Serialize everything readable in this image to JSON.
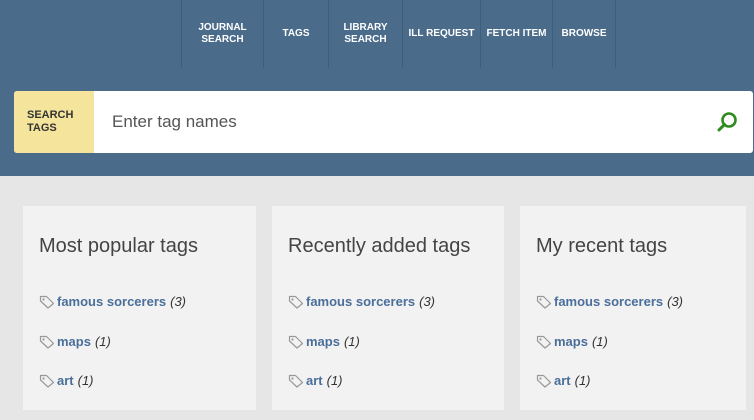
{
  "nav": {
    "items": [
      {
        "label_line1": "JOURNAL",
        "label_line2": "SEARCH"
      },
      {
        "label_line1": "TAGS",
        "label_line2": ""
      },
      {
        "label_line1": "LIBRARY",
        "label_line2": "SEARCH"
      },
      {
        "label_line1": "ILL REQUEST",
        "label_line2": ""
      },
      {
        "label_line1": "FETCH ITEM",
        "label_line2": ""
      },
      {
        "label_line1": "BROWSE",
        "label_line2": ""
      }
    ]
  },
  "search": {
    "label_line1": "SEARCH",
    "label_line2": "TAGS",
    "placeholder": "Enter tag names",
    "button_icon": "search-icon"
  },
  "panels": [
    {
      "title": "Most popular tags",
      "tags": [
        {
          "name": "famous sorcerers",
          "count": "(3)"
        },
        {
          "name": "maps",
          "count": "(1)"
        },
        {
          "name": "art",
          "count": "(1)"
        }
      ]
    },
    {
      "title": "Recently added tags",
      "tags": [
        {
          "name": "famous sorcerers",
          "count": "(3)"
        },
        {
          "name": "maps",
          "count": "(1)"
        },
        {
          "name": "art",
          "count": "(1)"
        }
      ]
    },
    {
      "title": "My recent tags",
      "tags": [
        {
          "name": "famous sorcerers",
          "count": "(3)"
        },
        {
          "name": "maps",
          "count": "(1)"
        },
        {
          "name": "art",
          "count": "(1)"
        }
      ]
    }
  ],
  "colors": {
    "header_bg": "#4a6b8a",
    "search_label_bg": "#f5e49c",
    "search_icon": "#2e8b1f",
    "tag_link": "#4a6f9a",
    "panel_bg": "#f2f2f2",
    "page_bg": "#e6e6e6"
  }
}
